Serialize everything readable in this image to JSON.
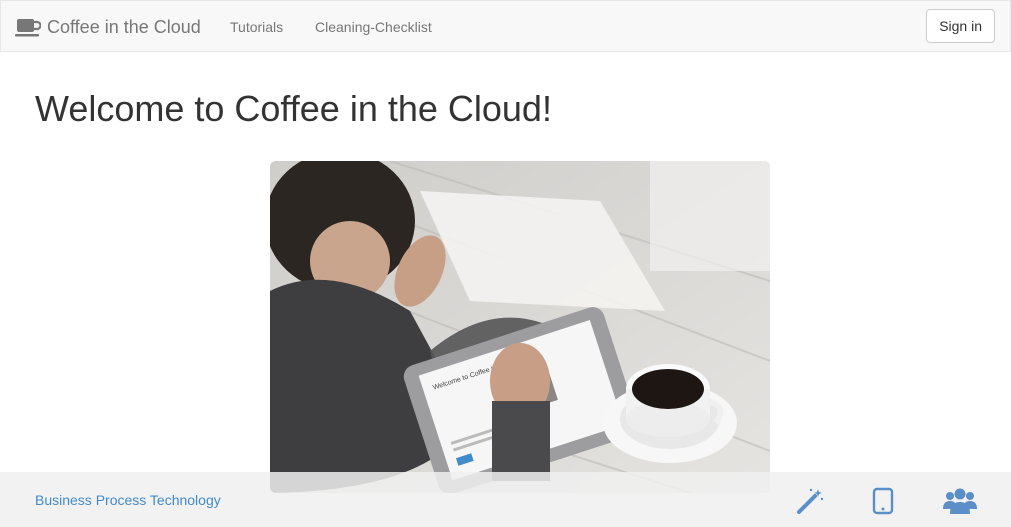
{
  "navbar": {
    "brand": "Coffee in the Cloud",
    "links": [
      "Tutorials",
      "Cleaning-Checklist"
    ],
    "signin_label": "Sign in"
  },
  "main": {
    "heading": "Welcome to Coffee in the Cloud!",
    "hero_image": {
      "alt": "Man using tablet next to coffee cup",
      "tablet_screen_title": "Welcome to Coffee in the Cloud!"
    }
  },
  "footer": {
    "link_label": "Business Process Technology",
    "icons": [
      "magic-wand-icon",
      "tablet-icon",
      "users-icon"
    ]
  },
  "colors": {
    "navbar_bg": "#f8f8f8",
    "link_blue": "#428bca",
    "icon_blue": "#5b8fc7"
  }
}
